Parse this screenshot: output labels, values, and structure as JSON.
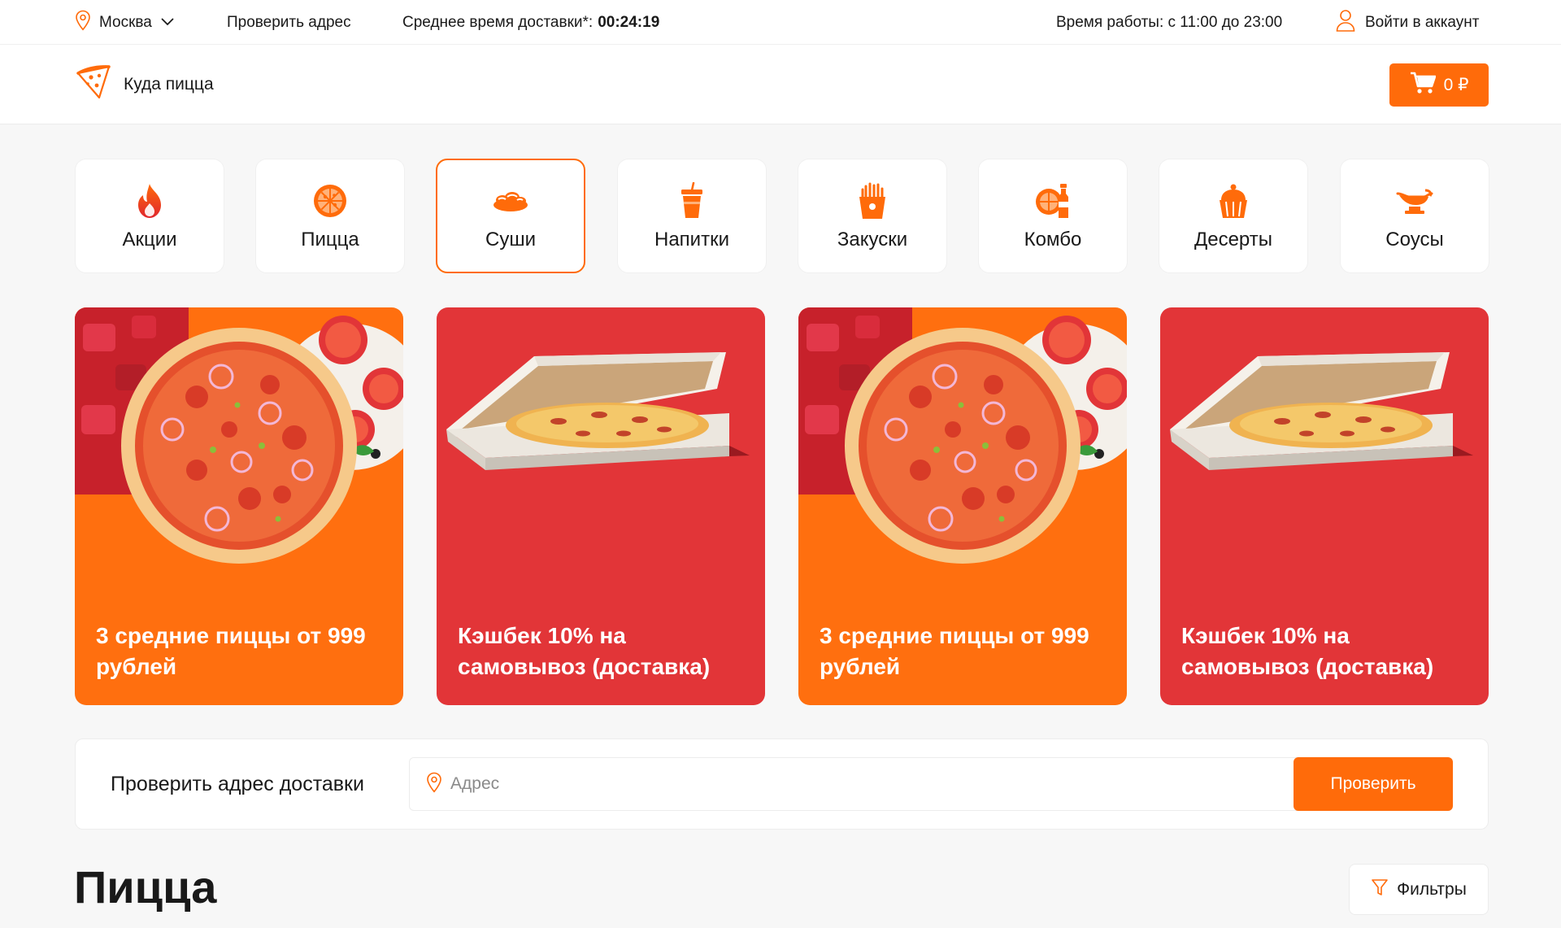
{
  "topbar": {
    "city": "Москва",
    "check_address": "Проверить адрес",
    "delivery_label": "Среднее время доставки*:",
    "delivery_time": "00:24:19",
    "work_hours": "Время работы: с 11:00 до 23:00",
    "login": "Войти в аккаунт"
  },
  "header": {
    "logo_text": "Куда пицца",
    "cart_total": "0 ₽"
  },
  "categories": [
    {
      "label": "Акции",
      "icon": "flame-icon",
      "active": false
    },
    {
      "label": "Пицца",
      "icon": "pizza-icon",
      "active": false
    },
    {
      "label": "Суши",
      "icon": "sushi-icon",
      "active": true
    },
    {
      "label": "Напитки",
      "icon": "drink-cup-icon",
      "active": false
    },
    {
      "label": "Закуски",
      "icon": "fries-icon",
      "active": false
    },
    {
      "label": "Комбо",
      "icon": "combo-icon",
      "active": false
    },
    {
      "label": "Десерты",
      "icon": "cupcake-icon",
      "active": false
    },
    {
      "label": "Соусы",
      "icon": "sauce-boat-icon",
      "active": false
    }
  ],
  "banners": [
    {
      "title": "3 средние пиццы от 999 рублей",
      "style": "orange"
    },
    {
      "title": "Кэшбек 10% на самовывоз (доставка)",
      "style": "red"
    },
    {
      "title": "3 средние пиццы от 999 рублей",
      "style": "orange"
    },
    {
      "title": "Кэшбек 10% на самовывоз (доставка)",
      "style": "red"
    }
  ],
  "address_check": {
    "label": "Проверить адрес доставки",
    "placeholder": "Адрес",
    "button": "Проверить"
  },
  "section": {
    "title": "Пицца",
    "filters": "Фильтры"
  },
  "colors": {
    "accent": "#ff6b0a",
    "banner_orange": "#ff6f0f",
    "banner_red": "#e23538"
  }
}
